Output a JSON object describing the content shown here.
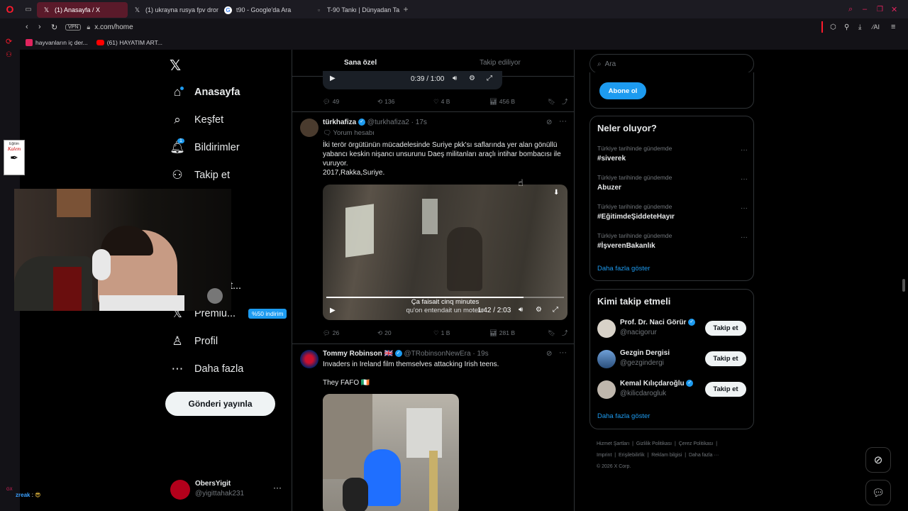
{
  "browser": {
    "tabs": [
      {
        "label": "(1) Anasayfa / X",
        "icon": "x-logo-icon",
        "active": true
      },
      {
        "label": "(1) ukrayna rusya fpv dron",
        "icon": "x-logo-icon",
        "active": false
      },
      {
        "label": "t90 - Google'da Ara",
        "icon": "google-icon",
        "active": false
      },
      {
        "label": "T-90 Tankı | Dünyadan Ta",
        "icon": "page-icon",
        "active": false
      }
    ],
    "url": "x.com/home",
    "vpn_label": "VPN",
    "ai_label": "AI",
    "bookmarks": [
      {
        "label": "hayvanların iç der...",
        "color": "#e0245e"
      },
      {
        "label": "(61) HAYATIM ART...",
        "color": "#ff0000"
      }
    ]
  },
  "nav": {
    "items": [
      {
        "label": "Anasayfa",
        "icon": "home-icon",
        "bold": true
      },
      {
        "label": "Keşfet",
        "icon": "search-icon"
      },
      {
        "label": "Bildirimler",
        "icon": "bell-icon",
        "badge": "1"
      },
      {
        "label": "Takip et",
        "icon": "add-person-icon"
      },
      {
        "label": "leri",
        "icon": "list-icon"
      },
      {
        "label": "eticisi St...",
        "icon": "creator-icon"
      },
      {
        "label": "Premiu...",
        "icon": "x-logo-icon",
        "promo": "%50 indirim"
      },
      {
        "label": "Profil",
        "icon": "person-icon"
      },
      {
        "label": "Daha fazla",
        "icon": "more-circle-icon"
      }
    ],
    "post_button": "Gönderi yayınla",
    "account": {
      "name": "ObersYigit",
      "handle": "@yigittahak231"
    }
  },
  "feed": {
    "tabs": [
      "Sana özel",
      "Takip ediliyor"
    ],
    "top_video_time": "0:39 / 1:00",
    "top_stats": {
      "replies": "49",
      "reposts": "136",
      "likes": "4 B",
      "views": "456 B"
    },
    "tweet1": {
      "name": "türkhafiza",
      "handle": "@turkhafiza2",
      "time": "· 17s",
      "sub": "Yorum hesabı",
      "text": "İki terör örgütünün mücadelesinde Suriye pkk'sı saflarında yer alan gönüllü yabancı keskin nişancı unsurunu Daeş militanları araçlı intihar bombacısı ile vuruyor.",
      "text2": "2017,Rakka,Suriye.",
      "caption1": "Ça faisait cinq minutes",
      "caption2": "qu'on entendait un moteur",
      "video_time": "1:42 / 2:03",
      "video_progress": 0.83,
      "stats": {
        "replies": "26",
        "reposts": "20",
        "likes": "1 B",
        "views": "281 B"
      }
    },
    "tweet2": {
      "name": "Tommy Robinson",
      "flag": "🇬🇧",
      "handle": "@TRobinsonNewEra",
      "time": "· 19s",
      "text": "Invaders in Ireland film themselves attacking Irish teens.",
      "text2": "They FAFO 🇮🇪"
    }
  },
  "right": {
    "search_placeholder": "Ara",
    "subscribe": "Abone ol",
    "trends_title": "Neler oluyor?",
    "trends": [
      {
        "context": "Türkiye tarihinde gündemde",
        "name": "#siverek"
      },
      {
        "context": "Türkiye tarihinde gündemde",
        "name": "Abuzer"
      },
      {
        "context": "Türkiye tarihinde gündemde",
        "name": "#EğitimdeŞiddeteHayır"
      },
      {
        "context": "Türkiye tarihinde gündemde",
        "name": "#İşverenBakanlık"
      }
    ],
    "show_more": "Daha fazla göster",
    "follow_title": "Kimi takip etmeli",
    "follow": [
      {
        "name": "Prof. Dr. Naci Görür",
        "handle": "@nacigorur",
        "button": "Takip et"
      },
      {
        "name": "Gezgin Dergisi",
        "handle": "@gezgindergi",
        "button": "Takip et"
      },
      {
        "name": "Kemal Kılıçdaroğlu",
        "handle": "@kilicdarogluk",
        "button": "Takip et"
      }
    ],
    "follow_more": "Daha fazla göster",
    "footer": [
      "Hizmet Şartları",
      "Gizlilik Politikası",
      "Çerez Politikası",
      "Imprint",
      "Erişilebilirlik",
      "Reklam bilgisi",
      "Daha fazla ···",
      "© 2026 X Corp."
    ]
  },
  "overlay": {
    "chat_user": "zreak",
    "chat_text": ":",
    "logo_text_top": "Eğitim",
    "logo_text": "Kalem"
  }
}
